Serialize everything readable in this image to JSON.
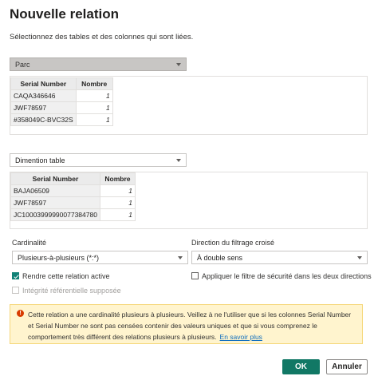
{
  "dialog": {
    "title": "Nouvelle relation",
    "subtitle": "Sélectionnez des tables et des colonnes qui sont liées."
  },
  "table1": {
    "selected": "Parc",
    "columns": [
      "Serial Number",
      "Nombre"
    ],
    "rows": [
      [
        "CAQA346646",
        "1"
      ],
      [
        "JWF78597",
        "1"
      ],
      [
        "#358049C-BVC32S",
        "1"
      ]
    ]
  },
  "table2": {
    "selected": "Dimention table",
    "columns": [
      "Serial Number",
      "Nombre"
    ],
    "rows": [
      [
        "BAJA06509",
        "1"
      ],
      [
        "JWF78597",
        "1"
      ],
      [
        "JC10003999990077384780",
        "1"
      ]
    ]
  },
  "cardinality": {
    "label": "Cardinalité",
    "value": "Plusieurs-à-plusieurs (*:*)"
  },
  "filter_direction": {
    "label": "Direction du filtrage croisé",
    "value": "À double sens"
  },
  "options": {
    "active_label": "Rendre cette relation active",
    "referential_label": "Intégrité référentielle supposée",
    "security_label": "Appliquer le filtre de sécurité dans les deux directions"
  },
  "warning": {
    "icon": "!",
    "text": "Cette relation a une cardinalité plusieurs à plusieurs. Veillez à ne l'utiliser que si les colonnes Serial Number et Serial Number ne sont pas censées contenir des valeurs uniques et que si vous comprenez le comportement très différent des relations plusieurs à plusieurs.",
    "link": "En savoir plus"
  },
  "buttons": {
    "ok": "OK",
    "cancel": "Annuler"
  },
  "colors": {
    "accent": "#117865",
    "warning_bg": "#fff4ce",
    "link": "#106ebe"
  }
}
